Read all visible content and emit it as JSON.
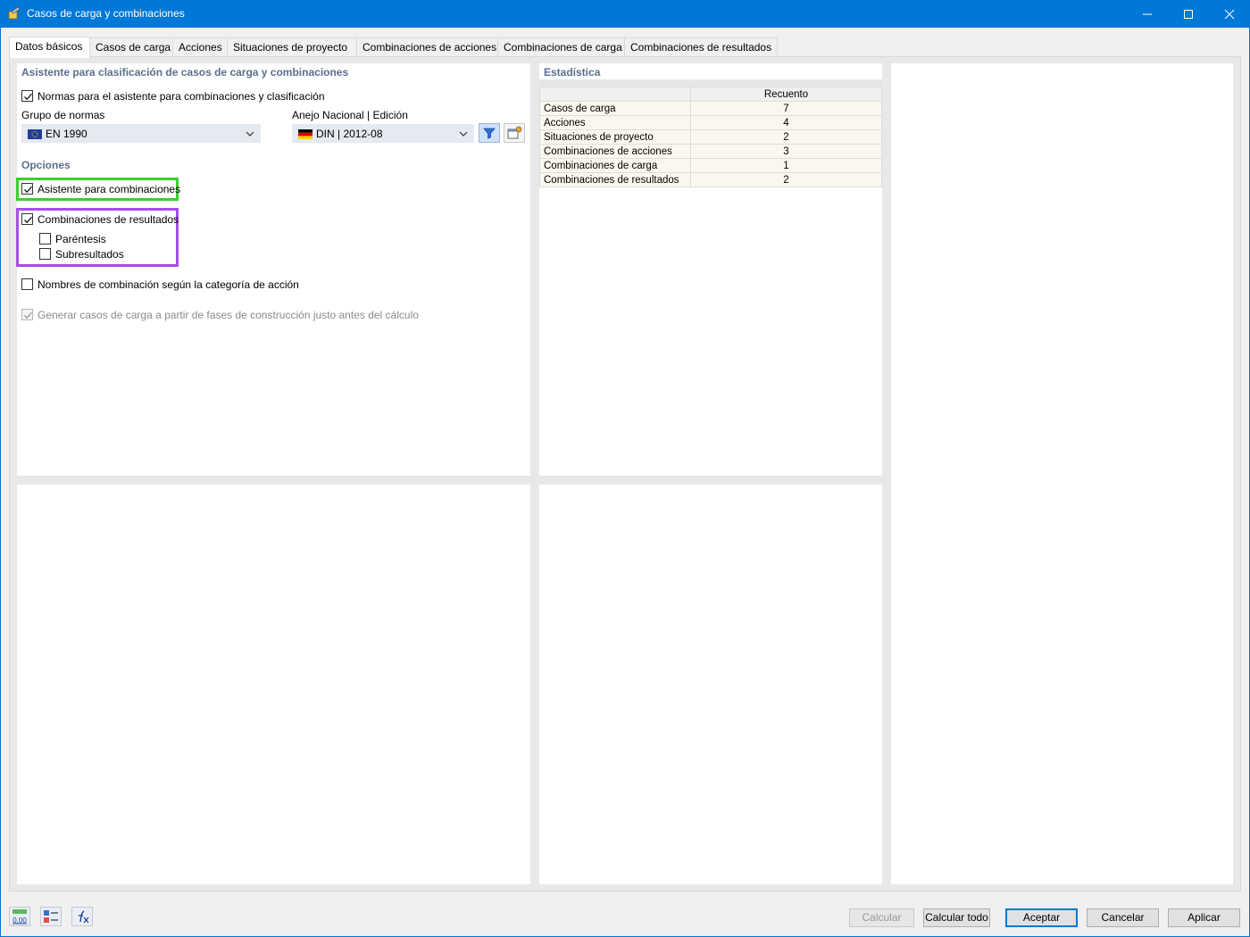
{
  "window": {
    "title": "Casos de carga y combinaciones"
  },
  "tabs": [
    {
      "label": "Datos básicos",
      "active": true
    },
    {
      "label": "Casos de carga"
    },
    {
      "label": "Acciones"
    },
    {
      "label": "Situaciones de proyecto"
    },
    {
      "label": "Combinaciones de acciones"
    },
    {
      "label": "Combinaciones de carga"
    },
    {
      "label": "Combinaciones de resultados"
    }
  ],
  "wizard": {
    "heading": "Asistente para clasificación de casos de carga y combinaciones",
    "standards_checkbox": {
      "label": "Normas para el asistente para combinaciones y clasificación",
      "checked": true
    },
    "standard_group": {
      "label": "Grupo de normas",
      "value": "EN 1990",
      "flag": "eu-flag-icon"
    },
    "national_annex": {
      "label": "Anejo Nacional | Edición",
      "value": "DIN | 2012-08",
      "flag": "germany-flag-icon"
    }
  },
  "options": {
    "heading": "Opciones",
    "combination_wizard": {
      "label": "Asistente para combinaciones",
      "checked": true
    },
    "result_combinations": {
      "label": "Combinaciones de resultados",
      "checked": true
    },
    "parentheses": {
      "label": "Paréntesis",
      "checked": false
    },
    "subresults": {
      "label": "Subresultados",
      "checked": false
    },
    "combination_names": {
      "label": "Nombres de combinación según la categoría de acción",
      "checked": false
    },
    "generate_load_cases": {
      "label": "Generar casos de carga a partir de fases de construcción justo antes del cálculo",
      "checked": true,
      "disabled": true
    }
  },
  "statistics": {
    "heading": "Estadística",
    "count_header": "Recuento",
    "rows": [
      {
        "name": "Casos de carga",
        "count": "7"
      },
      {
        "name": "Acciones",
        "count": "4"
      },
      {
        "name": "Situaciones de proyecto",
        "count": "2"
      },
      {
        "name": "Combinaciones de acciones",
        "count": "3"
      },
      {
        "name": "Combinaciones de carga",
        "count": "1"
      },
      {
        "name": "Combinaciones de resultados",
        "count": "2"
      }
    ]
  },
  "footer": {
    "tool_values": {
      "decimals_label": "0,00"
    },
    "buttons": {
      "calculate": "Calcular",
      "calculate_all": "Calcular todo",
      "ok": "Aceptar",
      "cancel": "Cancelar",
      "apply": "Aplicar"
    }
  },
  "colors": {
    "titlebar": "#0078d7",
    "section_heading": "#5a6f8c",
    "highlight_green": "#39d12b",
    "highlight_purple": "#a64ee6"
  }
}
